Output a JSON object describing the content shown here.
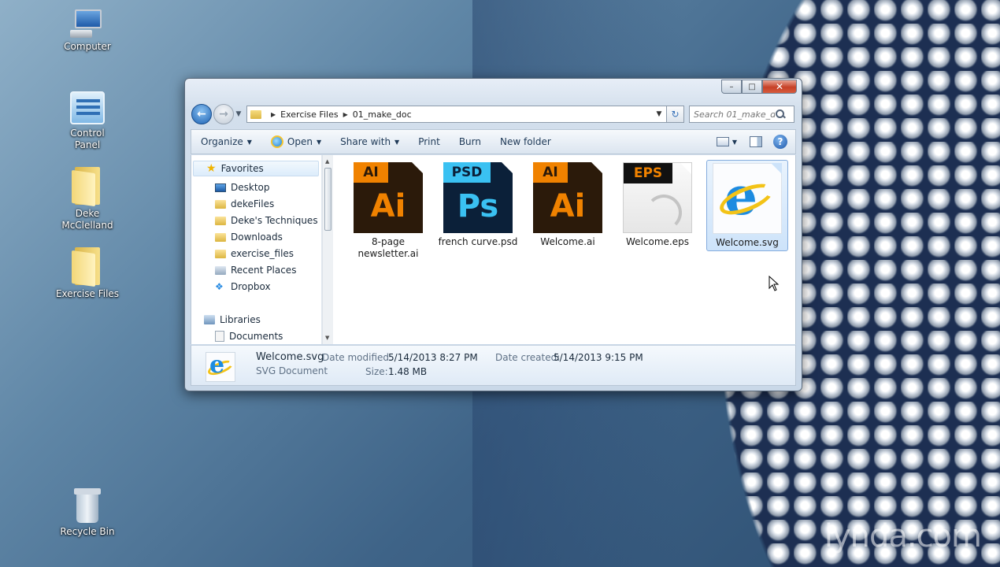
{
  "desktop": {
    "icons": [
      {
        "label": "Computer",
        "icon": "computer-icon"
      },
      {
        "label": "Control Panel",
        "icon": "control-panel-icon"
      },
      {
        "label": "Deke McClelland",
        "icon": "user-folder-icon"
      },
      {
        "label": "Exercise Files",
        "icon": "folder-icon"
      },
      {
        "label": "Recycle Bin",
        "icon": "recycle-bin-icon"
      }
    ],
    "watermark": "lynda.com"
  },
  "window": {
    "caption": {
      "minimize": "–",
      "maximize": "□",
      "close": "✕"
    },
    "address": {
      "path": [
        "Exercise Files",
        "01_make_doc"
      ],
      "search_placeholder": "Search 01_make_d..."
    },
    "toolbar": {
      "organize": "Organize",
      "open": "Open",
      "share_with": "Share with",
      "print": "Print",
      "burn": "Burn",
      "new_folder": "New folder"
    },
    "nav_pane": {
      "favorites": "Favorites",
      "items": [
        "Desktop",
        "dekeFiles",
        "Deke's Techniques",
        "Downloads",
        "exercise_files",
        "Recent Places",
        "Dropbox"
      ],
      "libraries": "Libraries",
      "library_items": [
        "Documents"
      ]
    },
    "files": [
      {
        "name": "8-page newsletter.ai",
        "badge": "AI",
        "glyph": "Ai",
        "type": "ai"
      },
      {
        "name": "french curve.psd",
        "badge": "PSD",
        "glyph": "Ps",
        "type": "psd"
      },
      {
        "name": "Welcome.ai",
        "badge": "AI",
        "glyph": "Ai",
        "type": "ai"
      },
      {
        "name": "Welcome.eps",
        "badge": "EPS",
        "glyph": "",
        "type": "eps"
      },
      {
        "name": "Welcome.svg",
        "badge": "",
        "glyph": "e",
        "type": "svg",
        "selected": true
      }
    ],
    "details": {
      "file_name": "Welcome.svg",
      "file_type": "SVG Document",
      "date_modified_label": "Date modified:",
      "date_modified": "5/14/2013 8:27 PM",
      "size_label": "Size:",
      "size": "1.48 MB",
      "date_created_label": "Date created:",
      "date_created": "5/14/2013 9:15 PM"
    }
  },
  "colors": {
    "accent": "#1d62b3",
    "close_button": "#c64027",
    "selection": "#cde3fa",
    "ai_orange": "#f08200",
    "ps_blue": "#3ac1f2"
  }
}
